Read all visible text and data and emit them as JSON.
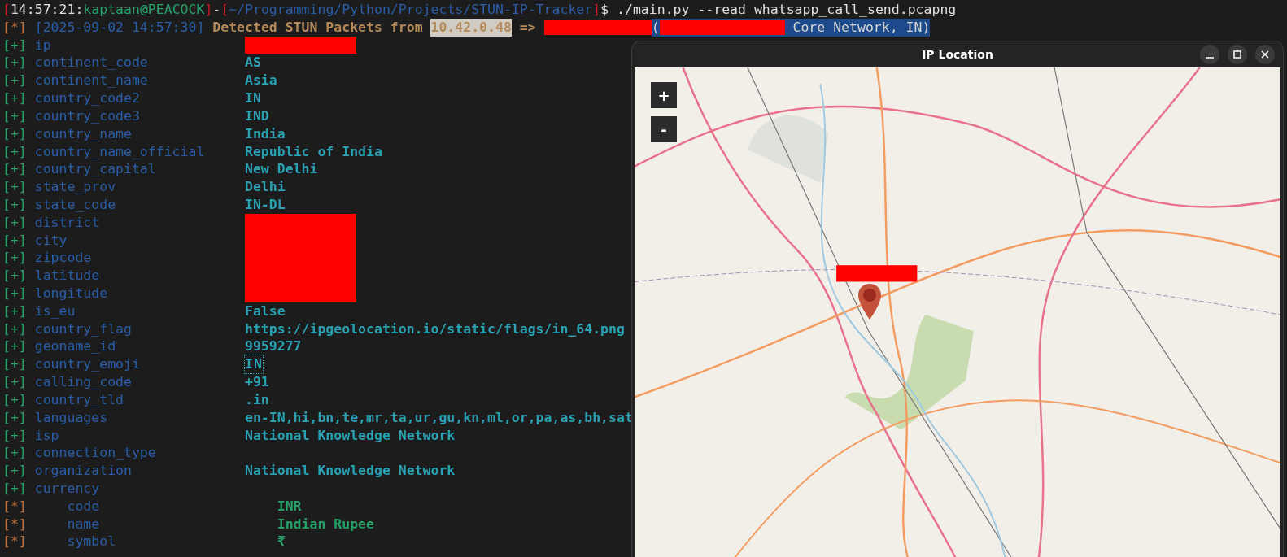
{
  "prompt": [
    {
      "text": "[",
      "kind": "bracket"
    },
    {
      "text": "14:57:21",
      "kind": "plain"
    },
    {
      "text": ":",
      "kind": "plain"
    },
    {
      "text": "kaptaan@PEACOCK",
      "kind": "user"
    },
    {
      "text": "]",
      "kind": "bracket"
    },
    {
      "text": "-",
      "kind": "plain"
    },
    {
      "text": "[",
      "kind": "bracket"
    },
    {
      "text": "~/Programming/Python/Projects/STUN-IP-Tracker",
      "kind": "path"
    },
    {
      "text": "]",
      "kind": "bracket"
    },
    {
      "text": "$ ./main.py --read whatsapp_call_send.pcapng",
      "kind": "plain"
    }
  ],
  "detection": {
    "bullet": "[*]",
    "timestamp": "[2025-09-02 14:57:30]",
    "message": "Detected STUN Packets from",
    "source_ip": "10.42.0.48",
    "arrow": "=>",
    "open_paren": "(",
    "network": " Core Network, IN)"
  },
  "rows": [
    {
      "bullet": "[+]",
      "kind": "plus",
      "key": "ip",
      "redacted": true
    },
    {
      "bullet": "[+]",
      "kind": "plus",
      "key": "continent_code",
      "value": "AS"
    },
    {
      "bullet": "[+]",
      "kind": "plus",
      "key": "continent_name",
      "value": "Asia"
    },
    {
      "bullet": "[+]",
      "kind": "plus",
      "key": "country_code2",
      "value": "IN"
    },
    {
      "bullet": "[+]",
      "kind": "plus",
      "key": "country_code3",
      "value": "IND"
    },
    {
      "bullet": "[+]",
      "kind": "plus",
      "key": "country_name",
      "value": "India"
    },
    {
      "bullet": "[+]",
      "kind": "plus",
      "key": "country_name_official",
      "value": "Republic of India"
    },
    {
      "bullet": "[+]",
      "kind": "plus",
      "key": "country_capital",
      "value": "New Delhi"
    },
    {
      "bullet": "[+]",
      "kind": "plus",
      "key": "state_prov",
      "value": "Delhi"
    },
    {
      "bullet": "[+]",
      "kind": "plus",
      "key": "state_code",
      "value": "IN-DL"
    },
    {
      "bullet": "[+]",
      "kind": "plus",
      "key": "district",
      "redacted": true
    },
    {
      "bullet": "[+]",
      "kind": "plus",
      "key": "city",
      "redacted": true
    },
    {
      "bullet": "[+]",
      "kind": "plus",
      "key": "zipcode",
      "redacted": true
    },
    {
      "bullet": "[+]",
      "kind": "plus",
      "key": "latitude",
      "redacted": true
    },
    {
      "bullet": "[+]",
      "kind": "plus",
      "key": "longitude",
      "redacted": true
    },
    {
      "bullet": "[+]",
      "kind": "plus",
      "key": "is_eu",
      "value": "False"
    },
    {
      "bullet": "[+]",
      "kind": "plus",
      "key": "country_flag",
      "value": "https://ipgeolocation.io/static/flags/in_64.png"
    },
    {
      "bullet": "[+]",
      "kind": "plus",
      "key": "geoname_id",
      "value": "9959277"
    },
    {
      "bullet": "[+]",
      "kind": "plus",
      "key": "country_emoji",
      "value": "IN",
      "boxed": true
    },
    {
      "bullet": "[+]",
      "kind": "plus",
      "key": "calling_code",
      "value": "+91"
    },
    {
      "bullet": "[+]",
      "kind": "plus",
      "key": "country_tld",
      "value": ".in"
    },
    {
      "bullet": "[+]",
      "kind": "plus",
      "key": "languages",
      "value": "en-IN,hi,bn,te,mr,ta,ur,gu,kn,ml,or,pa,as,bh,sat"
    },
    {
      "bullet": "[+]",
      "kind": "plus",
      "key": "isp",
      "value": "National Knowledge Network"
    },
    {
      "bullet": "[+]",
      "kind": "plus",
      "key": "connection_type"
    },
    {
      "bullet": "[+]",
      "kind": "plus",
      "key": "organization",
      "value": "National Knowledge Network"
    },
    {
      "bullet": "[+]",
      "kind": "plus",
      "key": "currency",
      "children": [
        {
          "bullet": "[*]",
          "kind": "star",
          "key": "code",
          "value": "INR"
        },
        {
          "bullet": "[*]",
          "kind": "star",
          "key": "name",
          "value": "Indian Rupee"
        },
        {
          "bullet": "[*]",
          "kind": "star",
          "key": "symbol",
          "value": "₹"
        }
      ]
    }
  ],
  "map_window": {
    "title": "IP Location",
    "zoom_in": "+",
    "zoom_out": "-"
  }
}
